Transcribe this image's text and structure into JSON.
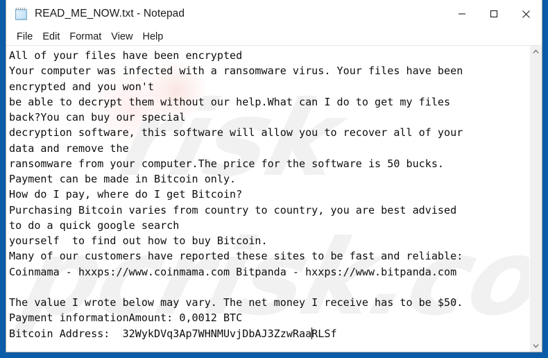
{
  "window": {
    "title": "READ_ME_NOW.txt - Notepad",
    "icon": "notepad-icon",
    "controls": {
      "minimize": "minimize-icon",
      "maximize": "maximize-icon",
      "close": "close-icon"
    },
    "desktop_color": "#0a5ba8",
    "chrome_color": "#ffffff"
  },
  "menu": {
    "items": [
      {
        "label": "File"
      },
      {
        "label": "Edit"
      },
      {
        "label": "Format"
      },
      {
        "label": "View"
      },
      {
        "label": "Help"
      }
    ]
  },
  "editor": {
    "text_before_caret": "All of your files have been encrypted\nYour computer was infected with a ransomware virus. Your files have been\nencrypted and you won't\nbe able to decrypt them without our help.What can I do to get my files\nback?You can buy our special\ndecryption software, this software will allow you to recover all of your\ndata and remove the\nransomware from your computer.The price for the software is 50 bucks.\nPayment can be made in Bitcoin only.\nHow do I pay, where do I get Bitcoin?\nPurchasing Bitcoin varies from country to country, you are best advised\nto do a quick google search\nyourself  to find out how to buy Bitcoin.\nMany of our customers have reported these sites to be fast and reliable:\nCoinmama - hxxps://www.coinmama.com Bitpanda - hxxps://www.bitpanda.com\n\nThe value I wrote below may vary. The net money I receive has to be $50.\nPayment informationAmount: 0,0012 BTC\nBitcoin Address:  32WykDVq3Ap7WHNMUvjDbAJ3ZzwRaa",
    "text_after_caret": "RLSf",
    "caret_present": true,
    "lines": [
      "All of your files have been encrypted",
      "Your computer was infected with a ransomware virus. Your files have been",
      "encrypted and you won't",
      "be able to decrypt them without our help.What can I do to get my files",
      "back?You can buy our special",
      "decryption software, this software will allow you to recover all of your",
      "data and remove the",
      "ransomware from your computer.The price for the software is 50 bucks.",
      "Payment can be made in Bitcoin only.",
      "How do I pay, where do I get Bitcoin?",
      "Purchasing Bitcoin varies from country to country, you are best advised",
      "to do a quick google search",
      "yourself  to find out how to buy Bitcoin.",
      "Many of our customers have reported these sites to be fast and reliable:",
      "Coinmama - hxxps://www.coinmama.com Bitpanda - hxxps://www.bitpanda.com",
      "",
      "The value I wrote below may vary. The net money I receive has to be $50.",
      "Payment informationAmount: 0,0012 BTC",
      "Bitcoin Address:  32WykDVq3Ap7WHNMUvjDbAJ3ZzwRaaRLSf"
    ],
    "ransom_details": {
      "price_usd": "50 bucks",
      "net_amount_usd": "$50.",
      "amount_btc": "0,0012 BTC",
      "bitcoin_address": "32WykDVq3Ap7WHNMUvjDbAJ3ZzwRaaRLSf",
      "exchange_sites": [
        "Coinmama - hxxps://www.coinmama.com",
        "Bitpanda - hxxps://www.bitpanda.com"
      ]
    },
    "text_color": "#0d0d0d",
    "background_color": "#ffffff"
  },
  "scrollbar": {
    "up_arrow": "chevron-up-icon",
    "down_arrow": "chevron-down-icon",
    "track_color": "#f0f0f0"
  },
  "watermark": {
    "text_1": "risk",
    "text_2": "pcrisk.com",
    "color": "#f1f1f1"
  }
}
